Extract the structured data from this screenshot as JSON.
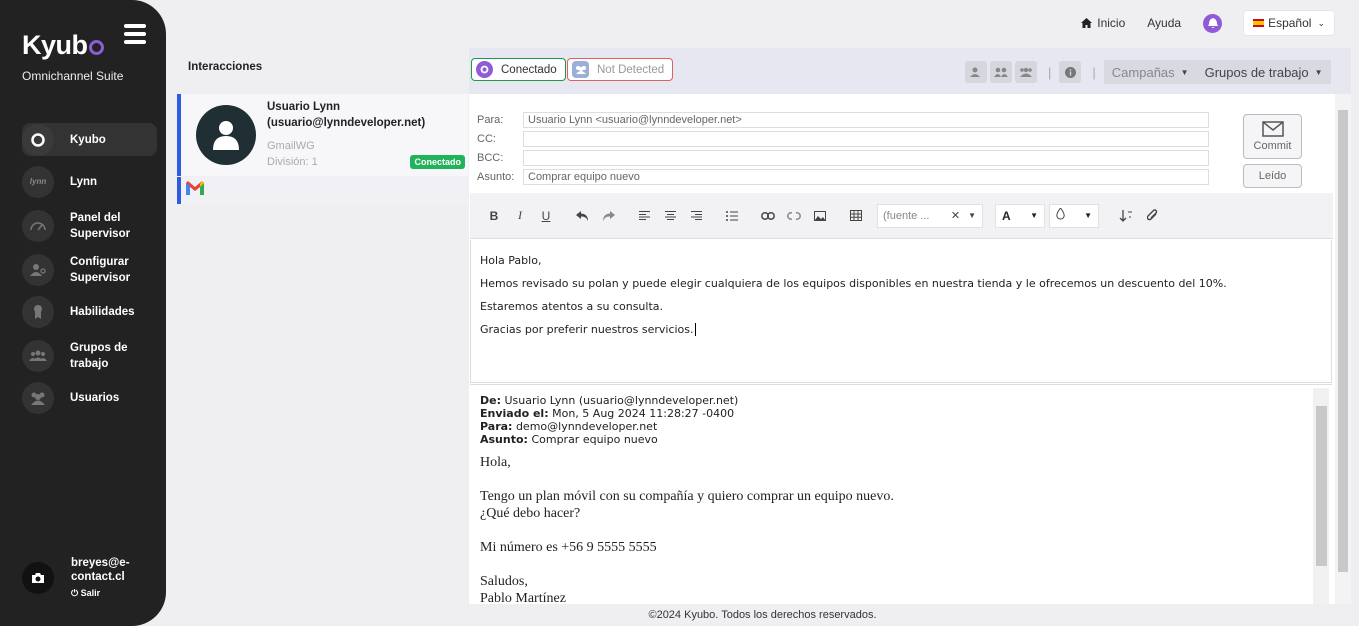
{
  "sidebar": {
    "logo": "Kyub",
    "suite": "Omnichannel Suite",
    "items": [
      {
        "label": "Kyubo",
        "icon": "kyubo-icon"
      },
      {
        "label": "Lynn",
        "icon": "lynn-icon",
        "icon_text": "lynn"
      },
      {
        "label": "Panel del Supervisor",
        "icon": "supervisor-panel-icon"
      },
      {
        "label": "Configurar Supervisor",
        "icon": "configure-supervisor-icon"
      },
      {
        "label": "Habilidades",
        "icon": "skills-icon"
      },
      {
        "label": "Grupos de trabajo",
        "icon": "workgroups-icon"
      },
      {
        "label": "Usuarios",
        "icon": "users-icon"
      }
    ],
    "user": {
      "email": "breyes@e-contact.cl",
      "logout": "Salir"
    }
  },
  "topbar": {
    "home": "Inicio",
    "help": "Ayuda",
    "language": "Español"
  },
  "interactions": {
    "title": "Interacciones",
    "card": {
      "name": "Usuario Lynn",
      "email": "(usuario@lynndeveloper.net)",
      "channel": "GmailWG",
      "division": "División: 1",
      "status": "Conectado"
    }
  },
  "panel": {
    "status_connected": "Conectado",
    "status_not_detected": "Not Detected",
    "campaigns": "Campañas",
    "workgroups": "Grupos de trabajo",
    "fields": {
      "to_label": "Para:",
      "to_value": "Usuario Lynn <usuario@lynndeveloper.net>",
      "cc_label": "CC:",
      "cc_value": "",
      "bcc_label": "BCC:",
      "bcc_value": "",
      "subject_label": "Asunto:",
      "subject_value": "Comprar equipo nuevo"
    },
    "commit": "Commit",
    "read": "Leído",
    "font_placeholder": "(fuente ..."
  },
  "editor": {
    "lines": [
      "Hola Pablo,",
      "Hemos revisado su polan y puede elegir cualquiera de los equipos disponibles en nuestra tienda y le ofrecemos un descuento del 10%.",
      "Estaremos atentos a su consulta.",
      "Gracias por preferir nuestros servicios."
    ]
  },
  "quoted": {
    "from_label": "De:",
    "from": "Usuario Lynn (usuario@lynndeveloper.net)",
    "sent_label": "Enviado el:",
    "sent": "Mon, 5 Aug 2024 11:28:27 -0400",
    "to_label": "Para:",
    "to": "demo@lynndeveloper.net",
    "subject_label": "Asunto:",
    "subject": "Comprar equipo nuevo",
    "body": [
      "Hola,",
      "",
      "Tengo un plan móvil con su compañía y quiero comprar un equipo nuevo.",
      "¿Qué debo hacer?",
      "",
      "Mi número es +56 9 5555 5555",
      "",
      "Saludos,",
      "Pablo Martínez"
    ]
  },
  "footer": "©2024 Kyubo. Todos los derechos reservados.",
  "colors": {
    "accent": "#8f5bd6",
    "connected": "#22b35a",
    "sidebar": "#222222",
    "selected_border": "#2d5be3"
  }
}
